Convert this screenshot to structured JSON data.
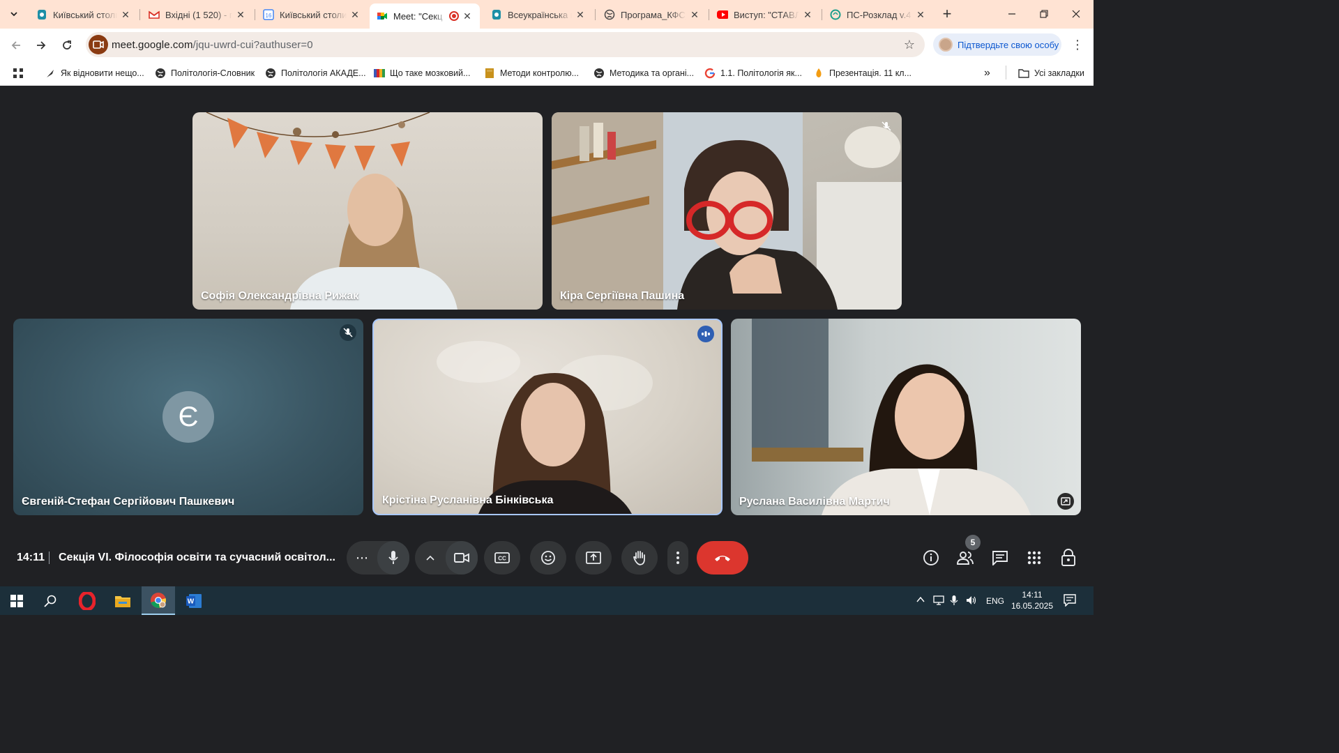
{
  "browser": {
    "tabs": [
      {
        "title": "Київський столи",
        "icon": "kyiv-uni-icon"
      },
      {
        "title": "Вхідні (1 520) - г",
        "icon": "gmail-icon"
      },
      {
        "title": "Київський столи",
        "icon": "calendar-16-icon"
      },
      {
        "title": "Meet: \"Секц",
        "icon": "meet-icon",
        "active": true
      },
      {
        "title": "Всеукраїнська н",
        "icon": "kyiv-uni-icon"
      },
      {
        "title": "Програма_КФС_",
        "icon": "globe-icon"
      },
      {
        "title": "Виступ: \"СТАВЛ",
        "icon": "youtube-icon"
      },
      {
        "title": "ПС-Розклад v.4.",
        "icon": "sheets-swirl-icon"
      }
    ],
    "new_tab_label": "+",
    "url_host": "meet.google.com",
    "url_path": "/jqu-uwrd-cui?authuser=0",
    "verify_label": "Підтвердьте свою особу",
    "bookmarks": [
      {
        "label": "Як відновити нещо...",
        "icon": "feather-icon"
      },
      {
        "label": "Політологія-Словник",
        "icon": "globe-icon"
      },
      {
        "label": "Політологія АКАДЕ...",
        "icon": "globe-icon"
      },
      {
        "label": "Що таке мозковий...",
        "icon": "colorful-logo-icon"
      },
      {
        "label": "Методи контролю...",
        "icon": "book-icon"
      },
      {
        "label": "Методика та органі...",
        "icon": "globe-icon"
      },
      {
        "label": "1.1. Політологія як...",
        "icon": "google-icon"
      },
      {
        "label": "Презентація. 11 кл...",
        "icon": "flame-icon"
      }
    ],
    "all_bookmarks_label": "Усі закладки"
  },
  "meet": {
    "participants": [
      {
        "name": "Софія Олександрівна Рижак",
        "muted": false
      },
      {
        "name": "Кіра Сергіївна Пашина",
        "muted": true
      },
      {
        "name": "Євгеній-Стефан Сергійович Пашкевич",
        "muted": true,
        "avatar_letter": "Є"
      },
      {
        "name": "Крістіна Русланівна Бінківська",
        "speaking": true
      },
      {
        "name": "Руслана Василівна Мартич",
        "presenting": true
      }
    ],
    "time": "14:11",
    "meeting_title": "Секція VI. Філософія освіти та сучасний освітол...",
    "people_count": "5",
    "colors": {
      "hangup": "#dc362e",
      "stage": "#202124",
      "control": "#333537",
      "speaking_border": "#a8c7fa"
    }
  },
  "taskbar": {
    "language": "ENG",
    "clock_time": "14:11",
    "clock_date": "16.05.2025"
  }
}
